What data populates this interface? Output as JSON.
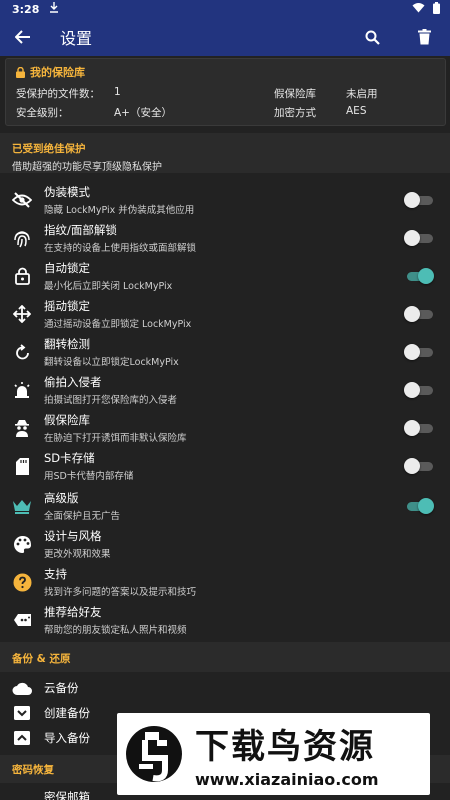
{
  "status_bar": {
    "time": "3:28"
  },
  "app_bar": {
    "title": "设置"
  },
  "vault": {
    "title": "我的保险库",
    "protected_files_label": "受保护的文件数：",
    "protected_files_value": "1",
    "fake_vault_label": "假保险库",
    "fake_vault_value": "未启用",
    "security_level_label": "安全级别：",
    "security_level_value": "A+（安全）",
    "encryption_label": "加密方式",
    "encryption_value": "AES"
  },
  "protection_section": {
    "title": "已受到绝佳保护",
    "subtitle": "借助超强的功能尽享顶级隐私保护"
  },
  "settings": [
    {
      "icon": "eye-off-icon",
      "title": "伪装模式",
      "subtitle": "隐藏 LockMyPix 并伪装成其他应用",
      "toggle": false
    },
    {
      "icon": "fingerprint-icon",
      "title": "指纹/面部解锁",
      "subtitle": "在支持的设备上使用指纹或面部解锁",
      "toggle": false
    },
    {
      "icon": "lock-icon",
      "title": "自动锁定",
      "subtitle": "最小化后立即关闭 LockMyPix",
      "toggle": true
    },
    {
      "icon": "move-icon",
      "title": "摇动锁定",
      "subtitle": "通过摇动设备立即锁定 LockMyPix",
      "toggle": false
    },
    {
      "icon": "rotate-icon",
      "title": "翻转检测",
      "subtitle": "翻转设备以立即锁定LockMyPix",
      "toggle": false
    },
    {
      "icon": "alarm-icon",
      "title": "偷拍入侵者",
      "subtitle": "拍摄试图打开您保险库的入侵者",
      "toggle": false
    },
    {
      "icon": "spy-icon",
      "title": "假保险库",
      "subtitle": "在胁迫下打开诱饵而非默认保险库",
      "toggle": false
    },
    {
      "icon": "sd-card-icon",
      "title": "SD卡存储",
      "subtitle": "用SD卡代替内部存储",
      "toggle": false
    },
    {
      "icon": "crown-icon",
      "title": "高级版",
      "subtitle": "全面保护且无广告",
      "toggle": true
    },
    {
      "icon": "palette-icon",
      "title": "设计与风格",
      "subtitle": "更改外观和效果"
    },
    {
      "icon": "help-icon",
      "title": "支持",
      "subtitle": "找到许多问题的答案以及提示和技巧"
    },
    {
      "icon": "share-icon",
      "title": "推荐给好友",
      "subtitle": "帮助您的朋友锁定私人照片和视频"
    }
  ],
  "backup_section": {
    "title": "备份 & 还原"
  },
  "backup_items": [
    {
      "icon": "cloud-icon",
      "title": "云备份"
    },
    {
      "icon": "archive-icon",
      "title": "创建备份"
    },
    {
      "icon": "import-icon",
      "title": "导入备份"
    }
  ],
  "password_section": {
    "title": "密码恢复"
  },
  "password_items": [
    {
      "title": "密保邮箱"
    }
  ],
  "watermark": {
    "brand": "下载鸟资源",
    "url": "www.xiazainiao.com"
  },
  "colors": {
    "app_bar": "#22347f",
    "accent": "#f5b43c",
    "toggle_on": "#4dbdb5",
    "background": "#222222"
  }
}
